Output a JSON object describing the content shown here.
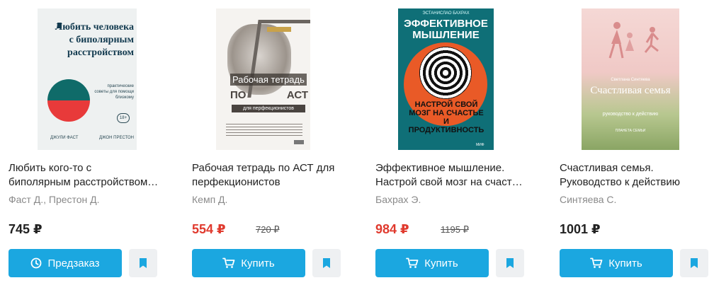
{
  "products": [
    {
      "title_lines": [
        "Любить кого-то с",
        "биполярным расстройством…"
      ],
      "author": "Фаст Д., Престон Д.",
      "price": "745 ₽",
      "old_price": "",
      "button_label": "Предзаказ",
      "button_icon": "clock-icon",
      "cover": {
        "title": "Любить человека с биполярным расстройством",
        "subtitle": "практические советы для помощи близкому",
        "age": "18+",
        "author_left": "ДЖУЛИ ФАСТ",
        "author_right": "ДЖОН ПРЕСТОН"
      }
    },
    {
      "title_lines": [
        "Рабочая тетрадь по АСТ для",
        "перфекционистов"
      ],
      "author": "Кемп Д.",
      "price": "554 ₽",
      "old_price": "720 ₽",
      "button_label": "Купить",
      "button_icon": "cart-icon",
      "cover": {
        "line1": "Рабочая тетрадь",
        "line2_left": "ПО",
        "line2_right": "АСТ",
        "line3": "для перфекционистов"
      }
    },
    {
      "title_lines": [
        "Эффективное мышление.",
        "Настрой свой мозг на счаст…"
      ],
      "author": "Бахрах Э.",
      "price": "984 ₽",
      "old_price": "1195 ₽",
      "button_label": "Купить",
      "button_icon": "cart-icon",
      "cover": {
        "author": "ЭСТАНИСЛАО БАХРАХ",
        "title": "ЭФФЕКТИВНОЕ МЫШЛЕНИЕ",
        "subtitle": "НАСТРОЙ СВОЙ МОЗГ НА СЧАСТЬЕ И ПРОДУКТИВНОСТЬ",
        "publisher": "МИФ"
      }
    },
    {
      "title_lines": [
        "Счастливая семья.",
        "Руководство к действию"
      ],
      "author": "Синтяева С.",
      "price": "1001 ₽",
      "old_price": "",
      "button_label": "Купить",
      "button_icon": "cart-icon",
      "cover": {
        "author": "Светлана Синтяева",
        "title": "Счастливая семья",
        "subtitle": "руководство к действию",
        "series": "ПЛАНЕТА СЕМЬИ"
      }
    }
  ],
  "colors": {
    "button_bg": "#1ba7e0",
    "sale_price": "#e03a2e",
    "bookmark_bg": "#eef0f2",
    "bookmark_icon": "#1ba7e0"
  },
  "icons": {
    "bookmark": "bookmark-icon"
  }
}
